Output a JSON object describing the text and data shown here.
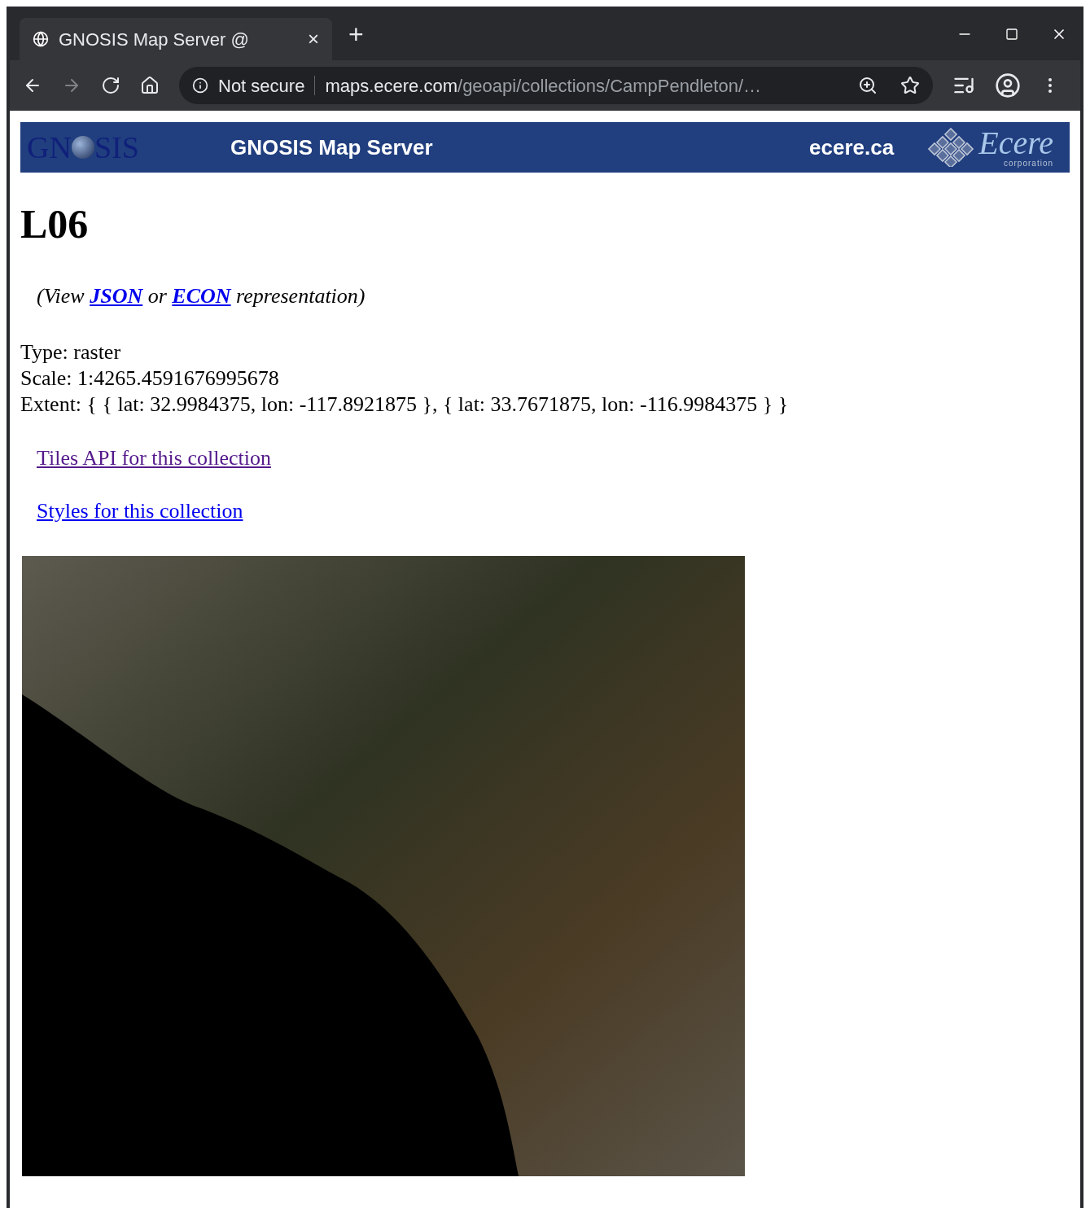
{
  "browser": {
    "tab": {
      "title": "GNOSIS Map Server @",
      "close": "×",
      "selected": true
    },
    "new_tab": "+",
    "address_bar": {
      "security": "Not secure",
      "host": "maps.ecere.com",
      "path": "/geoapi/collections/CampPendleton/…"
    }
  },
  "banner": {
    "logo_left": [
      "GN",
      "SIS"
    ],
    "title": "GNOSIS Map Server",
    "site": "ecere.ca",
    "logo_right": {
      "name": "Ecere",
      "tagline": "corporation"
    }
  },
  "page": {
    "heading": "L06",
    "representation": {
      "before": "(View",
      "links": [
        {
          "label": "JSON"
        },
        {
          "label": "ECON"
        }
      ],
      "between": "or",
      "after": "representation)"
    },
    "properties": [
      "Type: raster",
      "Scale: 1:4265.4591676995678",
      "Extent: { { lat: 32.9984375, lon: -117.8921875 }, { lat: 33.7671875, lon: -116.9984375 } }"
    ],
    "links": [
      {
        "label": "Tiles API for this collection",
        "visited": true
      },
      {
        "label": "Styles for this collection",
        "visited": false
      }
    ]
  }
}
